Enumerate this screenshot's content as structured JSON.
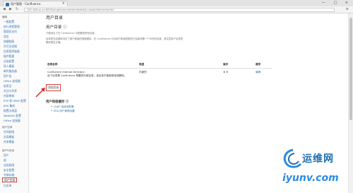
{
  "browser": {
    "tab_title": "用户管理 - Confluence",
    "tab_close": "×",
    "window_controls": "— □ ×",
    "back": "◀",
    "forward": "▶",
    "reload": "↻",
    "url": "192.168.xx.xx:8090/plugins/servlet/embedded-crowd/directories/list",
    "menu": "≡"
  },
  "sidebar": {
    "section_general": "通用",
    "general_items": [
      "一般配置",
      "执行进程管理",
      "管理员访问",
      "语言",
      "快捷链接",
      "许可证详情",
      "应用程序链接",
      "插件管理",
      "全局配置",
      "导入模板",
      "邮件服务器",
      "用户宏",
      "Office 连接器",
      "宏用法",
      "关注与共享",
      "内容审核",
      "POP 和 IMAP 配置",
      "JIRA 集成",
      "配置仪表盘",
      "WebDAV 配置",
      "Office 连接器"
    ],
    "section_spaces": "用户空间",
    "space_items": [
      "空间权限",
      "全局模板",
      "共享模板"
    ],
    "section_users": "用户&安全",
    "user_items": [
      "用户",
      "组",
      "全局权限",
      "安全配置",
      "令牌存储",
      "用户目录",
      "白名单"
    ]
  },
  "content": {
    "page_title": "用户目录",
    "section_title": "用户目录 ⓘ",
    "desc_lines": [
      "下面列出了在 Confluence 中配置的所有目录。",
      "目录的先后顺序决定了用户和组的搜索顺序，在 Confluence 中对用户和组的更改只会影响第一个可写的目录。请注意用户目录的",
      "顺序是否正确。"
    ],
    "table": {
      "headers": [
        "目录名称",
        "类型",
        "操作",
        "顺序"
      ],
      "rows": [
        {
          "name": "Confluence Internal Directory",
          "note": "这个目录是 Confluence 预置的内部目录，该目录不能被禁用或删除。",
          "type": "内部的",
          "ops": "⬇ ⬆",
          "order": "编辑"
        }
      ]
    },
    "add_button": "添加目录",
    "user_section_title": "用户和组缓存 ⓘ",
    "bullets": [
      "LDAP 连接池配置",
      "JIRA 用户管理设置"
    ]
  },
  "watermark": {
    "cn": "运维网",
    "en": "iyunv.com"
  },
  "colors": {
    "link": "#3572b0",
    "highlight_border": "#d04437",
    "arrow": "#e02020",
    "watermark_blue": "#1f6fb0"
  }
}
